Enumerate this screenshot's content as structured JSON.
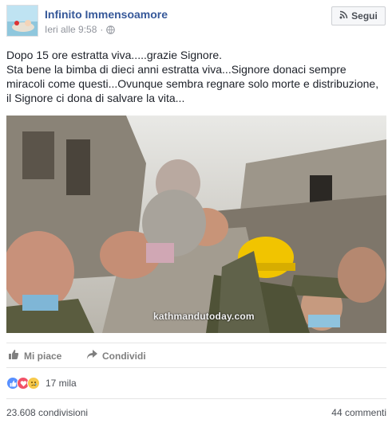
{
  "post": {
    "page_name": "Infinito Immensoamore",
    "timestamp": "Ieri alle 9:58",
    "timestamp_separator": "·",
    "privacy_icon": "globe-icon",
    "follow_label": "Segui",
    "text_lines": [
      "Dopo 15 ore estratta viva.....grazie Signore.",
      "Sta bene la bimba di dieci anni estratta viva...Signore donaci sempre miracoli come questi...Ovunque sembra regnare solo morte e distribuzione, il Signore ci dona di salvare la vita..."
    ],
    "photo_watermark": "kathmandutoday.com"
  },
  "actions": {
    "like_label": "Mi piace",
    "share_label": "Condividi"
  },
  "reactions": {
    "types": [
      "like",
      "love",
      "sad"
    ],
    "count": "17 mila"
  },
  "stats": {
    "shares": "23.608 condivisioni",
    "comments": "44 commenti"
  },
  "colors": {
    "link_blue": "#365899",
    "text": "#1d2129",
    "muted": "#90949c",
    "like_blue": "#5890ff",
    "love_red": "#f25268",
    "sad_yellow": "#f7c94a"
  }
}
